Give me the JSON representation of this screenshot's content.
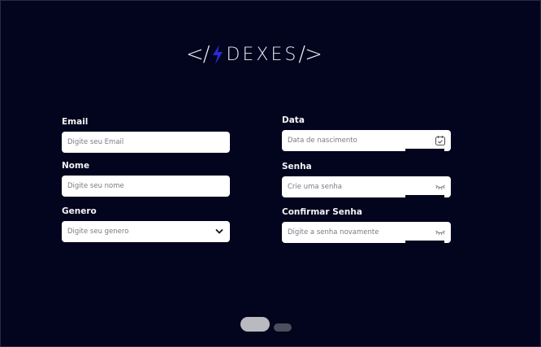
{
  "logo": {
    "left_bracket": "</",
    "name": "DEXES",
    "right_bracket": "/>",
    "accent_color": "#2b2bd6"
  },
  "form": {
    "email": {
      "label": "Email",
      "placeholder": "Digite seu Email"
    },
    "nome": {
      "label": "Nome",
      "placeholder": "Digite seu nome"
    },
    "genero": {
      "label": "Genero",
      "placeholder": "Digite seu genero",
      "icon": "chevron-down-icon"
    },
    "data": {
      "label": "Data",
      "placeholder": "Data de nascimento",
      "icon": "calendar-check-icon"
    },
    "senha": {
      "label": "Senha",
      "placeholder": "Crie uma senha",
      "icon": "eye-closed-icon"
    },
    "confirmar_senha": {
      "label": "Confirmar Senha",
      "placeholder": "Digite a senha novamente",
      "icon": "eye-closed-icon"
    }
  },
  "pagination": {
    "current_page": 1,
    "total_pages": 2
  },
  "colors": {
    "background": "#03041d",
    "input_background": "#ffffff",
    "label": "#f4f4f8"
  }
}
